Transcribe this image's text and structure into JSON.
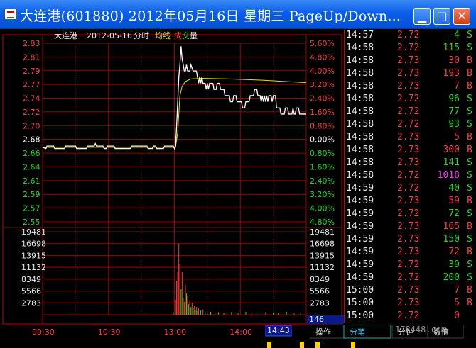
{
  "window": {
    "title": "大连港(601880) 2012年05月16日 星期三 PageUp/Down...",
    "buttons": {
      "minimize": "▁",
      "maximize": "□",
      "close": "✕"
    }
  },
  "header": {
    "stock_name": "大连港",
    "date": "2012-05-16",
    "mode": "分时",
    "avg_label": "均线",
    "vol_label_a": "成",
    "vol_label_b": "交",
    "vol_label_c": "量"
  },
  "colors": {
    "up": "#ff3c3c",
    "down": "#22dd22",
    "neutral": "#ffffff",
    "grid": "#a00000",
    "avg": "#e8e000",
    "magenta": "#ff33ff"
  },
  "chart_data": {
    "type": "line",
    "price_axis": {
      "left_labels": [
        "2.83",
        "2.81",
        "2.79",
        "2.77",
        "2.74",
        "2.72",
        "2.70",
        "2.68",
        "2.66",
        "2.64",
        "2.61",
        "2.59",
        "2.57",
        "2.55"
      ],
      "right_labels": [
        "5.60%",
        "4.80%",
        "4.00%",
        "3.20%",
        "2.40%",
        "1.60%",
        "0.80%",
        "0.00%",
        "0.80%",
        "1.60%",
        "2.40%",
        "3.20%",
        "4.00%",
        "4.80%"
      ],
      "ylim": [
        2.545,
        2.835
      ],
      "prev_close": 2.68
    },
    "volume_axis": {
      "labels": [
        "19481",
        "16698",
        "13915",
        "11132",
        "8349",
        "5566",
        "2783"
      ],
      "ylim": [
        0,
        19481
      ]
    },
    "x_labels": [
      "09:30",
      "10:30",
      "13:00",
      "14:00"
    ],
    "cursor_time": "14:43",
    "cursor_volume": "146",
    "tabs": [
      "操作",
      "分笔",
      "分钟",
      "数值"
    ],
    "price_series": [
      [
        0,
        2.666
      ],
      [
        3,
        2.664
      ],
      [
        4,
        2.668
      ],
      [
        10,
        2.668
      ],
      [
        11,
        2.664
      ],
      [
        20,
        2.664
      ],
      [
        21,
        2.668
      ],
      [
        30,
        2.668
      ],
      [
        31,
        2.664
      ],
      [
        40,
        2.664
      ],
      [
        41,
        2.668
      ],
      [
        47,
        2.668
      ],
      [
        48,
        2.672
      ],
      [
        49,
        2.668
      ],
      [
        55,
        2.668
      ],
      [
        56,
        2.664
      ],
      [
        58,
        2.664
      ],
      [
        59,
        2.668
      ],
      [
        65,
        2.668
      ],
      [
        66,
        2.664
      ],
      [
        80,
        2.664
      ],
      [
        81,
        2.668
      ],
      [
        95,
        2.668
      ],
      [
        96,
        2.664
      ],
      [
        100,
        2.664
      ],
      [
        101,
        2.668
      ],
      [
        103,
        2.668
      ],
      [
        104,
        2.664
      ],
      [
        110,
        2.664
      ],
      [
        111,
        2.668
      ],
      [
        119,
        2.668
      ],
      [
        120,
        2.664
      ],
      [
        121,
        2.668
      ],
      [
        122,
        2.7
      ],
      [
        123,
        2.74
      ],
      [
        124,
        2.78
      ],
      [
        125,
        2.8
      ],
      [
        126,
        2.83
      ],
      [
        127,
        2.81
      ],
      [
        128,
        2.8
      ],
      [
        129,
        2.79
      ],
      [
        130,
        2.79
      ],
      [
        131,
        2.8
      ],
      [
        132,
        2.79
      ],
      [
        134,
        2.79
      ],
      [
        135,
        2.8
      ],
      [
        137,
        2.79
      ],
      [
        140,
        2.79
      ],
      [
        141,
        2.78
      ],
      [
        142,
        2.77
      ],
      [
        143,
        2.78
      ],
      [
        144,
        2.77
      ],
      [
        145,
        2.78
      ],
      [
        146,
        2.77
      ],
      [
        148,
        2.77
      ],
      [
        149,
        2.76
      ],
      [
        150,
        2.77
      ],
      [
        151,
        2.76
      ],
      [
        152,
        2.77
      ],
      [
        155,
        2.77
      ],
      [
        156,
        2.76
      ],
      [
        158,
        2.76
      ],
      [
        159,
        2.77
      ],
      [
        161,
        2.77
      ],
      [
        162,
        2.76
      ],
      [
        165,
        2.76
      ],
      [
        166,
        2.75
      ],
      [
        170,
        2.75
      ],
      [
        171,
        2.74
      ],
      [
        173,
        2.74
      ],
      [
        174,
        2.75
      ],
      [
        176,
        2.75
      ],
      [
        177,
        2.74
      ],
      [
        181,
        2.74
      ],
      [
        182,
        2.73
      ],
      [
        184,
        2.73
      ],
      [
        185,
        2.74
      ],
      [
        188,
        2.74
      ],
      [
        189,
        2.75
      ],
      [
        192,
        2.75
      ],
      [
        193,
        2.76
      ],
      [
        195,
        2.76
      ],
      [
        196,
        2.75
      ],
      [
        198,
        2.75
      ],
      [
        199,
        2.74
      ],
      [
        200,
        2.75
      ],
      [
        201,
        2.74
      ],
      [
        202,
        2.75
      ],
      [
        203,
        2.74
      ],
      [
        204,
        2.75
      ],
      [
        205,
        2.74
      ],
      [
        206,
        2.75
      ],
      [
        208,
        2.75
      ],
      [
        209,
        2.74
      ],
      [
        210,
        2.75
      ],
      [
        212,
        2.75
      ],
      [
        213,
        2.73
      ],
      [
        216,
        2.73
      ],
      [
        217,
        2.72
      ],
      [
        220,
        2.72
      ],
      [
        221,
        2.73
      ],
      [
        223,
        2.73
      ],
      [
        224,
        2.72
      ],
      [
        227,
        2.72
      ],
      [
        228,
        2.73
      ],
      [
        229,
        2.72
      ],
      [
        230,
        2.72
      ],
      [
        231,
        2.73
      ],
      [
        233,
        2.73
      ],
      [
        234,
        2.72
      ],
      [
        240,
        2.72
      ]
    ],
    "avg_series": [
      [
        0,
        2.666
      ],
      [
        121,
        2.666
      ],
      [
        123,
        2.69
      ],
      [
        125,
        2.75
      ],
      [
        127,
        2.765
      ],
      [
        130,
        2.773
      ],
      [
        135,
        2.777
      ],
      [
        145,
        2.778
      ],
      [
        170,
        2.777
      ],
      [
        200,
        2.775
      ],
      [
        220,
        2.773
      ],
      [
        240,
        2.771
      ]
    ],
    "volume_bars": [
      [
        119,
        600,
        "down"
      ],
      [
        121,
        3500,
        "up"
      ],
      [
        122,
        8000,
        "up"
      ],
      [
        123,
        10000,
        "up"
      ],
      [
        124,
        16698,
        "up"
      ],
      [
        125,
        12000,
        "up"
      ],
      [
        126,
        6000,
        "down"
      ],
      [
        127,
        10000,
        "up"
      ],
      [
        128,
        4000,
        "down"
      ],
      [
        129,
        3000,
        "up"
      ],
      [
        130,
        7000,
        "up"
      ],
      [
        131,
        5000,
        "down"
      ],
      [
        132,
        4500,
        "up"
      ],
      [
        133,
        2500,
        "down"
      ],
      [
        134,
        3200,
        "up"
      ],
      [
        135,
        1800,
        "down"
      ],
      [
        136,
        2800,
        "up"
      ],
      [
        137,
        1500,
        "down"
      ],
      [
        138,
        2000,
        "up"
      ],
      [
        139,
        1200,
        "down"
      ],
      [
        140,
        1800,
        "up"
      ],
      [
        141,
        900,
        "down"
      ],
      [
        142,
        1500,
        "up"
      ],
      [
        144,
        1000,
        "down"
      ],
      [
        146,
        1200,
        "up"
      ],
      [
        148,
        700,
        "down"
      ],
      [
        150,
        600,
        "up"
      ],
      [
        153,
        700,
        "down"
      ],
      [
        157,
        500,
        "up"
      ],
      [
        160,
        600,
        "down"
      ],
      [
        165,
        500,
        "up"
      ],
      [
        172,
        600,
        "down"
      ],
      [
        178,
        400,
        "up"
      ],
      [
        185,
        700,
        "down"
      ],
      [
        190,
        500,
        "up"
      ],
      [
        197,
        400,
        "down"
      ],
      [
        203,
        600,
        "up"
      ],
      [
        210,
        500,
        "down"
      ],
      [
        215,
        400,
        "up"
      ],
      [
        222,
        700,
        "down"
      ],
      [
        229,
        300,
        "up"
      ],
      [
        235,
        500,
        "down"
      ]
    ]
  },
  "ticks": [
    {
      "time": "14:57",
      "price": "2.72",
      "vol": "4",
      "side": "S",
      "vc": "down"
    },
    {
      "time": "14:58",
      "price": "2.72",
      "vol": "115",
      "side": "S",
      "vc": "down"
    },
    {
      "time": "14:58",
      "price": "2.73",
      "vol": "30",
      "side": "B",
      "vc": "up"
    },
    {
      "time": "14:58",
      "price": "2.73",
      "vol": "193",
      "side": "B",
      "vc": "up"
    },
    {
      "time": "14:58",
      "price": "2.73",
      "vol": "7",
      "side": "B",
      "vc": "up"
    },
    {
      "time": "14:58",
      "price": "2.72",
      "vol": "96",
      "side": "S",
      "vc": "down"
    },
    {
      "time": "14:58",
      "price": "2.72",
      "vol": "77",
      "side": "S",
      "vc": "down"
    },
    {
      "time": "14:58",
      "price": "2.72",
      "vol": "93",
      "side": "S",
      "vc": "down"
    },
    {
      "time": "14:58",
      "price": "2.73",
      "vol": "5",
      "side": "B",
      "vc": "up"
    },
    {
      "time": "14:58",
      "price": "2.73",
      "vol": "300",
      "side": "B",
      "vc": "up"
    },
    {
      "time": "14:58",
      "price": "2.73",
      "vol": "141",
      "side": "S",
      "vc": "down"
    },
    {
      "time": "14:58",
      "price": "2.72",
      "vol": "1018",
      "side": "S",
      "vc": "magenta"
    },
    {
      "time": "14:59",
      "price": "2.72",
      "vol": "40",
      "side": "S",
      "vc": "down"
    },
    {
      "time": "14:59",
      "price": "2.73",
      "vol": "59",
      "side": "B",
      "vc": "up"
    },
    {
      "time": "14:59",
      "price": "2.72",
      "vol": "72",
      "side": "S",
      "vc": "down"
    },
    {
      "time": "14:59",
      "price": "2.73",
      "vol": "165",
      "side": "B",
      "vc": "up"
    },
    {
      "time": "14:59",
      "price": "2.73",
      "vol": "150",
      "side": "S",
      "vc": "down"
    },
    {
      "time": "14:59",
      "price": "2.73",
      "vol": "72",
      "side": "B",
      "vc": "up"
    },
    {
      "time": "14:59",
      "price": "2.72",
      "vol": "39",
      "side": "S",
      "vc": "down"
    },
    {
      "time": "14:59",
      "price": "2.72",
      "vol": "200",
      "side": "S",
      "vc": "down"
    },
    {
      "time": "15:00",
      "price": "2.73",
      "vol": "7",
      "side": "B",
      "vc": "up"
    },
    {
      "time": "15:00",
      "price": "2.73",
      "vol": "5",
      "side": "B",
      "vc": "up"
    },
    {
      "time": "15:00",
      "price": "2.72",
      "vol": "0",
      "side": "",
      "vc": "up"
    }
  ],
  "watermark": "178448.com"
}
